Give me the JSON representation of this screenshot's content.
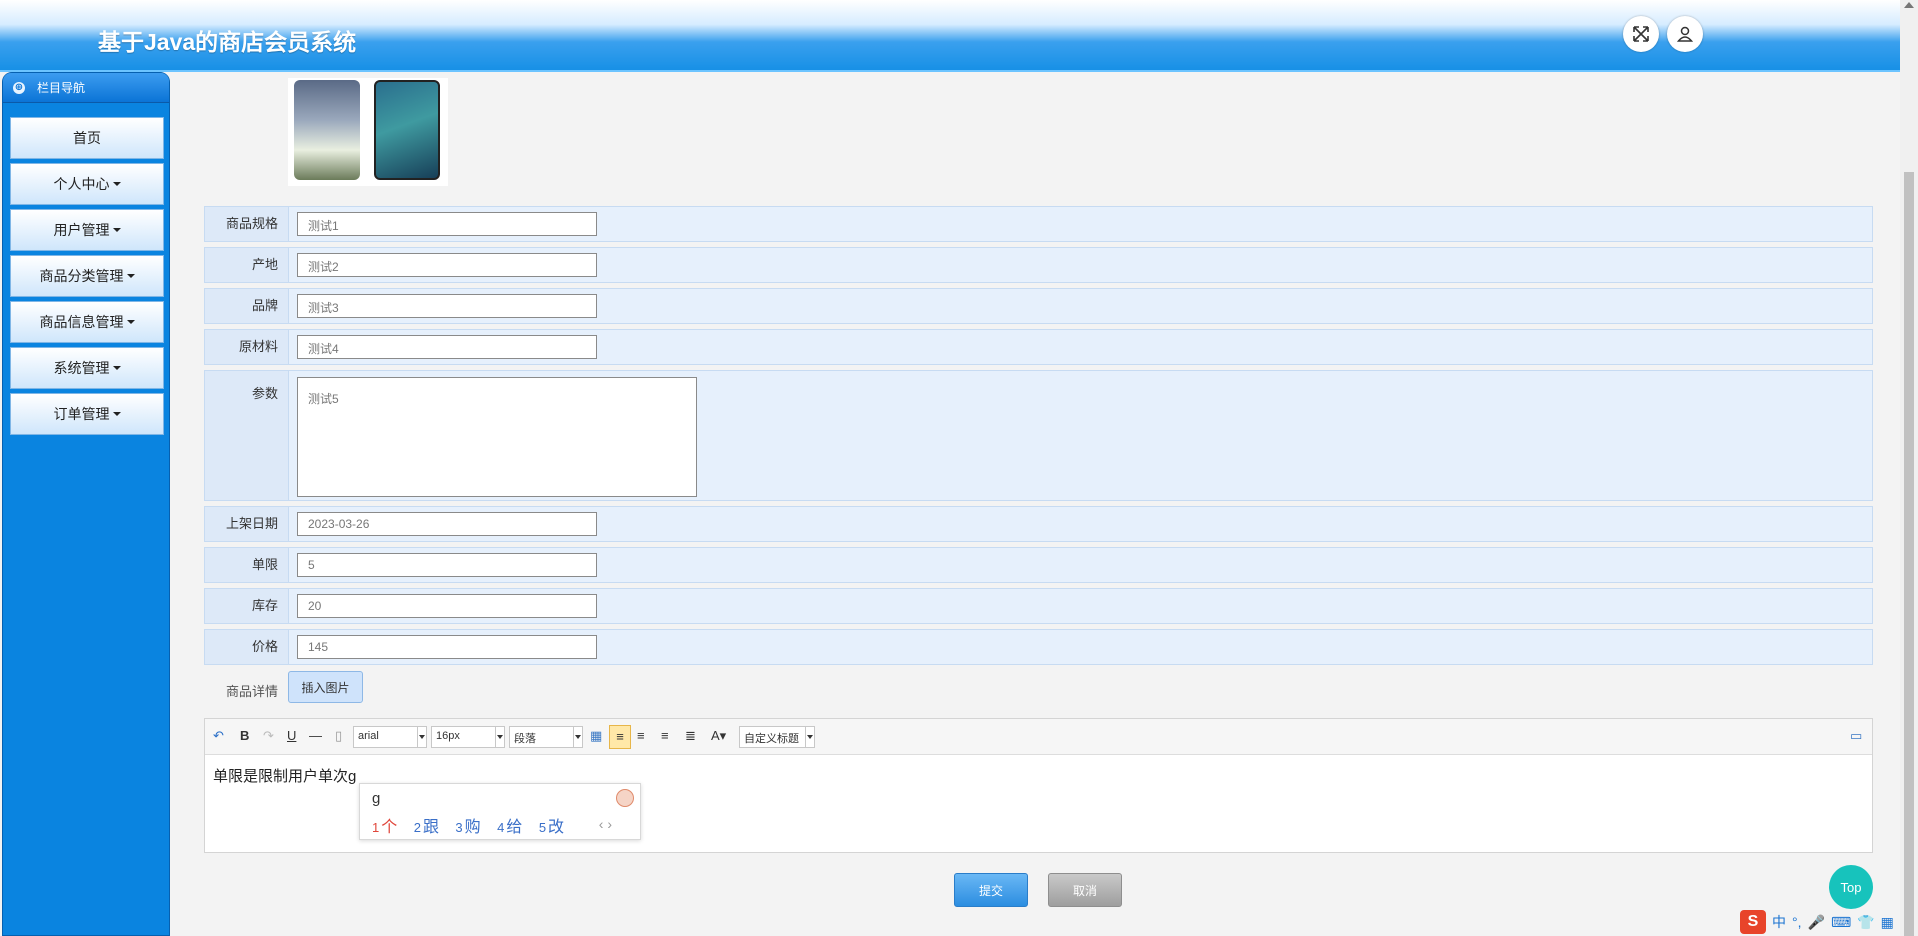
{
  "app": {
    "title": "基于Java的商店会员系统"
  },
  "sidebar": {
    "header": "栏目导航",
    "items": [
      {
        "label": "首页",
        "has_caret": false
      },
      {
        "label": "个人中心",
        "has_caret": true
      },
      {
        "label": "用户管理",
        "has_caret": true
      },
      {
        "label": "商品分类管理",
        "has_caret": true
      },
      {
        "label": "商品信息管理",
        "has_caret": true
      },
      {
        "label": "系统管理",
        "has_caret": true
      },
      {
        "label": "订单管理",
        "has_caret": true
      }
    ]
  },
  "form": {
    "spec": {
      "label": "商品规格",
      "value": "测试1"
    },
    "origin": {
      "label": "产地",
      "value": "测试2"
    },
    "brand": {
      "label": "品牌",
      "value": "测试3"
    },
    "material": {
      "label": "原材料",
      "value": "测试4"
    },
    "params": {
      "label": "参数",
      "value": "测试5"
    },
    "date": {
      "label": "上架日期",
      "value": "2023-03-26"
    },
    "limit": {
      "label": "单限",
      "value": "5"
    },
    "stock": {
      "label": "库存",
      "value": "20"
    },
    "price": {
      "label": "价格",
      "value": "145"
    },
    "detail": {
      "label": "商品详情",
      "insert_button": "插入图片"
    }
  },
  "editor": {
    "font": "arial",
    "size": "16px",
    "paragraph": "段落",
    "custom_title": "自定义标题",
    "content": "单限是限制用户单次g"
  },
  "ime": {
    "typed": "g",
    "candidates": [
      {
        "n": "1",
        "text": "个"
      },
      {
        "n": "2",
        "text": "跟"
      },
      {
        "n": "3",
        "text": "购"
      },
      {
        "n": "4",
        "text": "给"
      },
      {
        "n": "5",
        "text": "改"
      }
    ]
  },
  "actions": {
    "submit": "提交",
    "cancel": "取消",
    "top": "Top"
  },
  "tray": {
    "ime_mode": "中"
  },
  "colors": {
    "accent": "#1790e6",
    "sidebar": "#0a84e0",
    "row_bg": "#e6f0fc",
    "top_button": "#17c3bc"
  }
}
